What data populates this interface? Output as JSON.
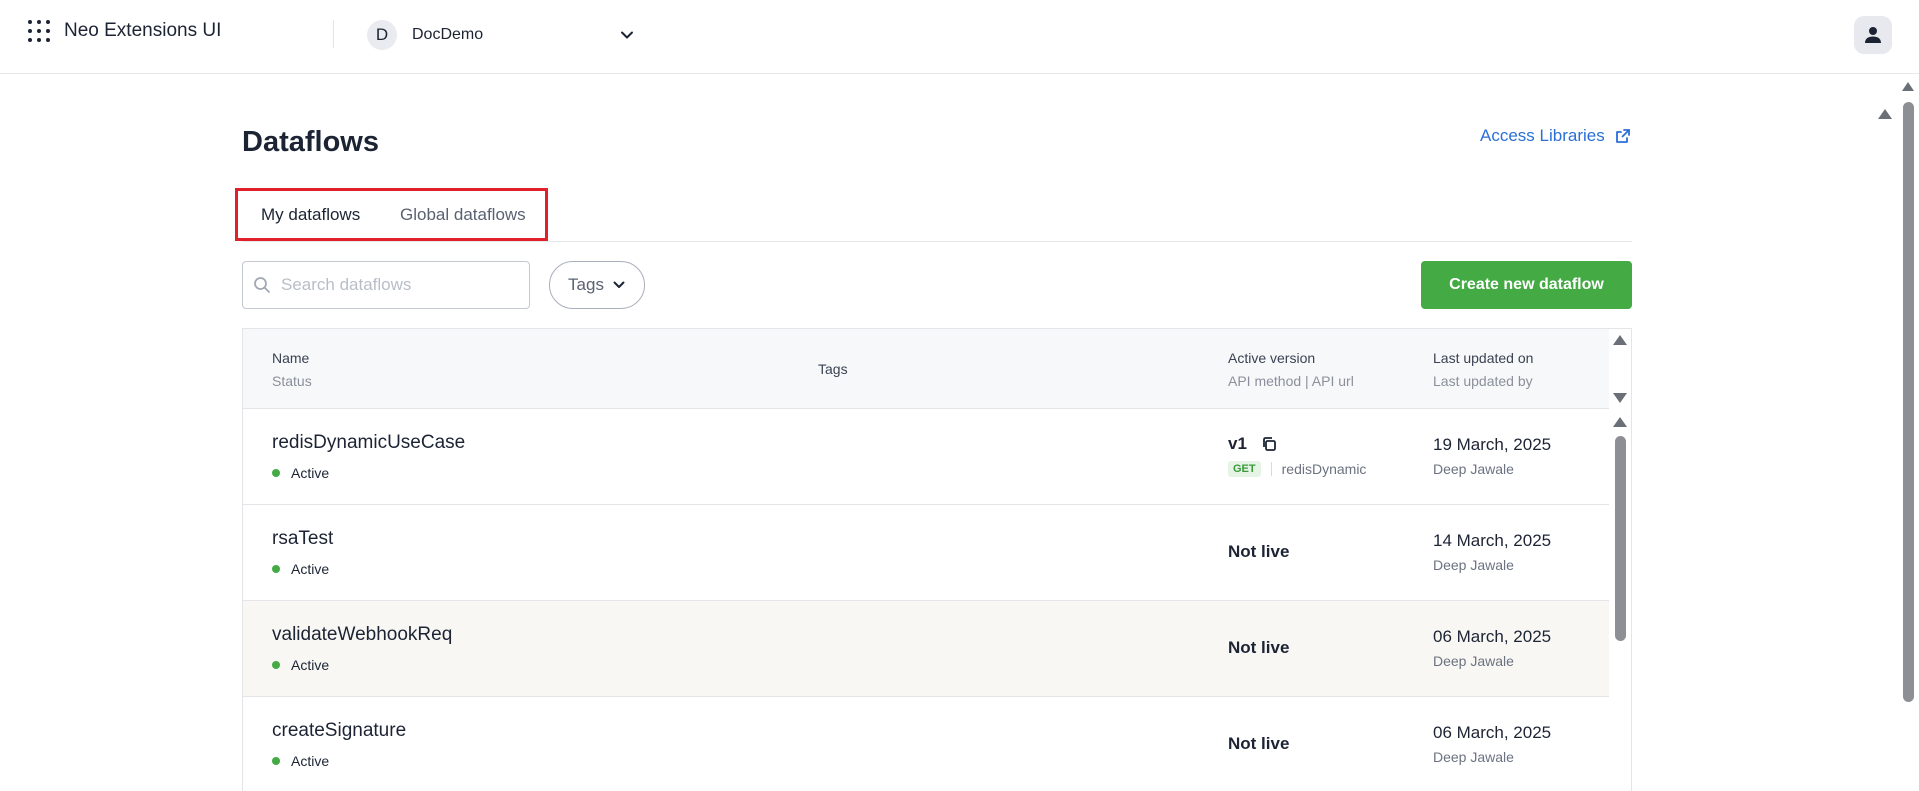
{
  "app": {
    "title": "Neo Extensions UI"
  },
  "workspace": {
    "initial": "D",
    "name": "DocDemo"
  },
  "page": {
    "title": "Dataflows",
    "access_link": "Access Libraries"
  },
  "tabs": [
    {
      "label": "My dataflows",
      "active": true
    },
    {
      "label": "Global dataflows",
      "active": false
    }
  ],
  "toolbar": {
    "search_placeholder": "Search dataflows",
    "tags_label": "Tags",
    "create_label": "Create new dataflow"
  },
  "table": {
    "headers": {
      "name": "Name",
      "status": "Status",
      "tags": "Tags",
      "active_version": "Active version",
      "api_sub": "API method | API url",
      "last_updated_on": "Last updated on",
      "last_updated_by": "Last updated by"
    },
    "rows": [
      {
        "name": "redisDynamicUseCase",
        "status": "Active",
        "version": "v1",
        "method": "GET",
        "api_url": "redisDynamic",
        "date": "19 March, 2025",
        "by": "Deep Jawale"
      },
      {
        "name": "rsaTest",
        "status": "Active",
        "live": "Not live",
        "date": "14 March, 2025",
        "by": "Deep Jawale"
      },
      {
        "name": "validateWebhookReq",
        "status": "Active",
        "live": "Not live",
        "date": "06 March, 2025",
        "by": "Deep Jawale"
      },
      {
        "name": "createSignature",
        "status": "Active",
        "live": "Not live",
        "date": "06 March, 2025",
        "by": "Deep Jawale"
      }
    ]
  },
  "colors": {
    "accent": "#43aa44",
    "link": "#2b6fd6",
    "highlight": "#e0202a"
  },
  "icons": [
    "apps-grid-icon",
    "chevron-down-icon",
    "user-icon",
    "external-link-icon",
    "search-icon",
    "copy-icon"
  ]
}
